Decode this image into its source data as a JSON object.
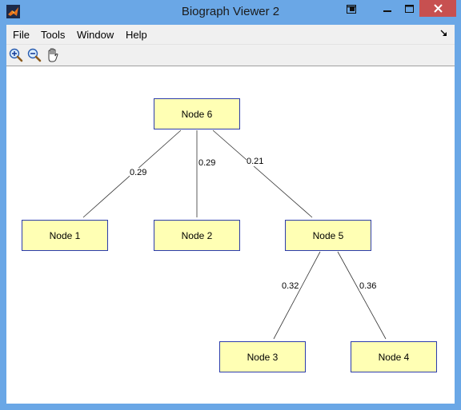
{
  "window": {
    "title": "Biograph Viewer 2"
  },
  "menu": {
    "items": [
      "File",
      "Tools",
      "Window",
      "Help"
    ]
  },
  "toolbar": {
    "tools": [
      "zoom-in-icon",
      "zoom-out-icon",
      "pan-hand-icon"
    ]
  },
  "graph": {
    "nodes": [
      {
        "id": "n6",
        "label": "Node 6"
      },
      {
        "id": "n1",
        "label": "Node 1"
      },
      {
        "id": "n2",
        "label": "Node 2"
      },
      {
        "id": "n5",
        "label": "Node 5"
      },
      {
        "id": "n3",
        "label": "Node 3"
      },
      {
        "id": "n4",
        "label": "Node 4"
      }
    ],
    "edges": [
      {
        "from": "Node 6",
        "to": "Node 1",
        "weight": "0.29"
      },
      {
        "from": "Node 6",
        "to": "Node 2",
        "weight": "0.29"
      },
      {
        "from": "Node 6",
        "to": "Node 5",
        "weight": "0.21"
      },
      {
        "from": "Node 5",
        "to": "Node 3",
        "weight": "0.32"
      },
      {
        "from": "Node 5",
        "to": "Node 4",
        "weight": "0.36"
      }
    ]
  },
  "colors": {
    "titlebar": "#6aa7e6",
    "node_fill": "#ffffb4",
    "node_border": "#2c3cab",
    "close_button": "#c75050"
  }
}
